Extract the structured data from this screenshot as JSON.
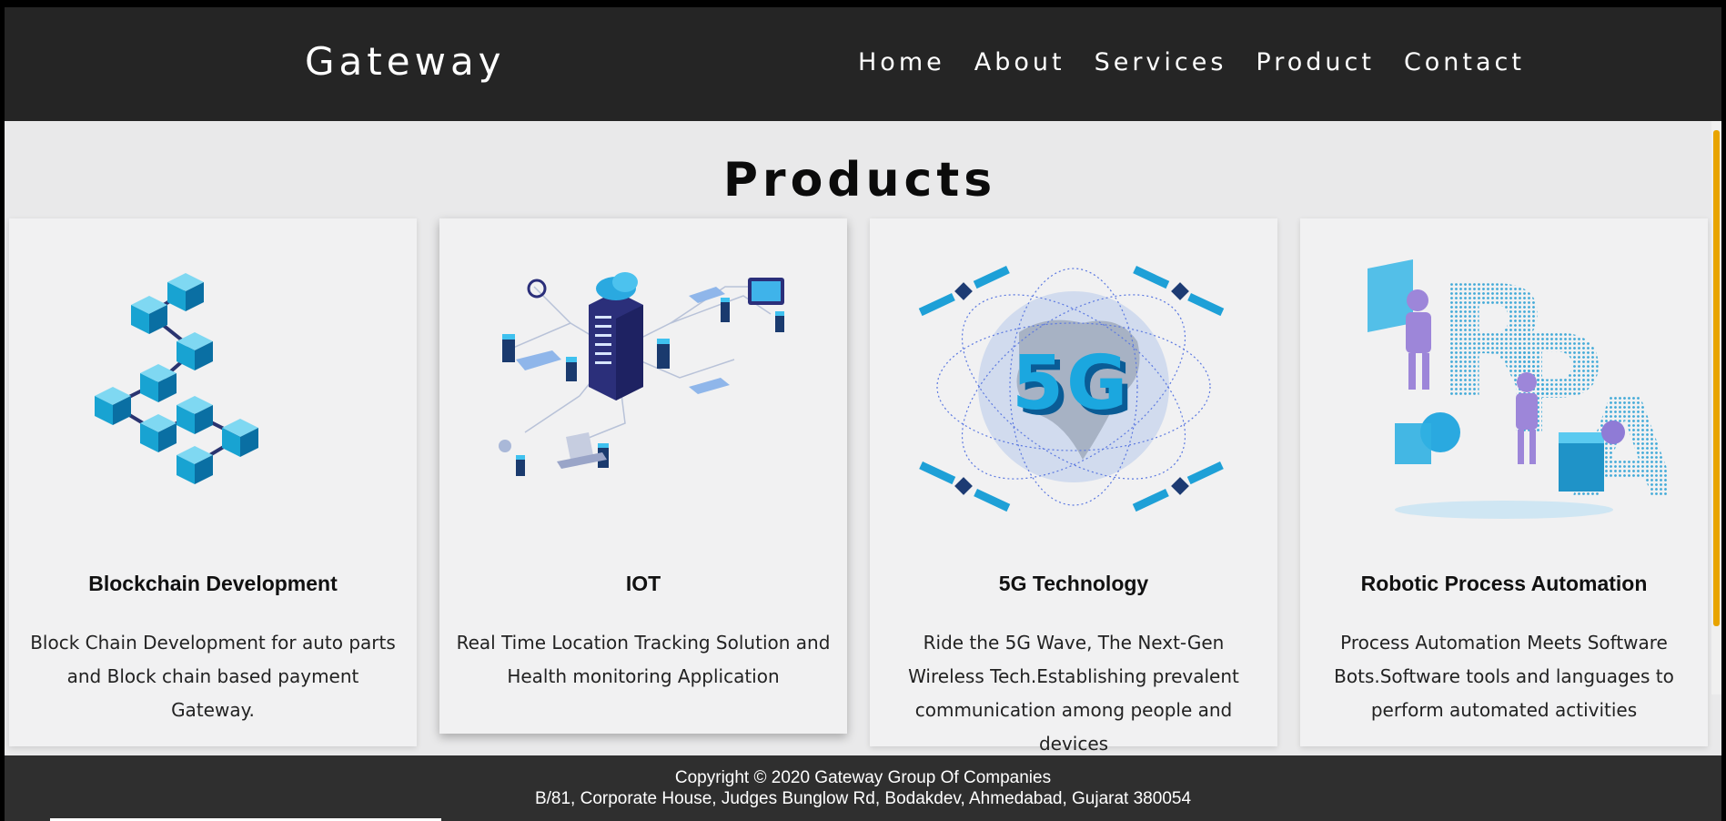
{
  "brand": "Gateway",
  "nav": [
    "Home",
    "About",
    "Services",
    "Product",
    "Contact"
  ],
  "heading": "Products",
  "products": [
    {
      "title": "Blockchain Development",
      "desc": "Block Chain Development for auto parts and Block chain based payment Gateway.",
      "icon": "blockchain-cubes-illustration"
    },
    {
      "title": "IOT",
      "desc": "Real Time Location Tracking Solution and Health monitoring Application",
      "icon": "iot-server-network-illustration"
    },
    {
      "title": "5G Technology",
      "desc": "Ride the 5G Wave, The Next-Gen Wireless Tech.Establishing prevalent communication among people and devices",
      "icon": "5g-globe-satellites-illustration"
    },
    {
      "title": "Robotic Process Automation",
      "desc": "Process Automation Meets Software Bots.Software tools and languages to perform automated activities",
      "icon": "rpa-robots-illustration"
    }
  ],
  "footer": {
    "copyright": "Copyright © 2020 Gateway Group Of Companies",
    "address": "B/81, Corporate House, Judges Bunglow Rd, Bodakdev, Ahmedabad, Gujarat 380054"
  },
  "colors": {
    "navbar": "#252525",
    "background": "#e9e9ea",
    "card": "#f1f1f2",
    "accent": "#1aa3d4",
    "footer": "#2f2f2f",
    "scrollbar": "#e8a400"
  }
}
